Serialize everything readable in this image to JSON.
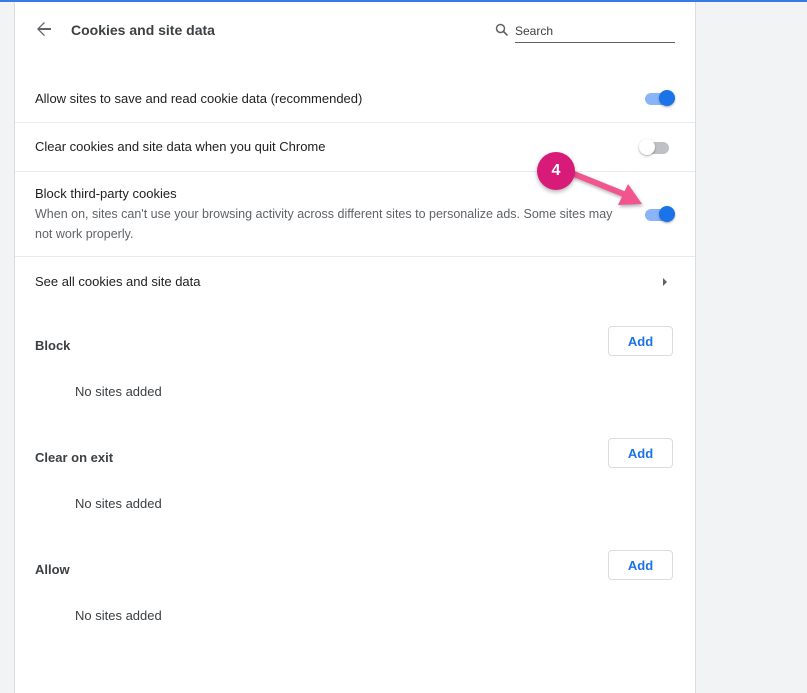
{
  "header": {
    "title": "Cookies and site data",
    "search_placeholder": "Search"
  },
  "settings": {
    "allow_save": {
      "label": "Allow sites to save and read cookie data (recommended)",
      "enabled": true
    },
    "clear_on_quit": {
      "label": "Clear cookies and site data when you quit Chrome",
      "enabled": false
    },
    "block_third_party": {
      "label": "Block third-party cookies",
      "description": "When on, sites can't use your browsing activity across different sites to personalize ads. Some sites may not work properly.",
      "enabled": true
    },
    "see_all": {
      "label": "See all cookies and site data"
    }
  },
  "sections": [
    {
      "title": "Block",
      "add_label": "Add",
      "empty_text": "No sites added"
    },
    {
      "title": "Clear on exit",
      "add_label": "Add",
      "empty_text": "No sites added"
    },
    {
      "title": "Allow",
      "add_label": "Add",
      "empty_text": "No sites added"
    }
  ],
  "annotation": {
    "step": "4",
    "color": "#d81b78"
  },
  "colors": {
    "accent": "#1a73e8",
    "toggle_track_on": "#8ab4f8",
    "annotation_arrow": "#f0548e"
  },
  "icons": {
    "back": "arrow-left-icon",
    "search": "search-icon",
    "chevron": "chevron-right-icon"
  }
}
